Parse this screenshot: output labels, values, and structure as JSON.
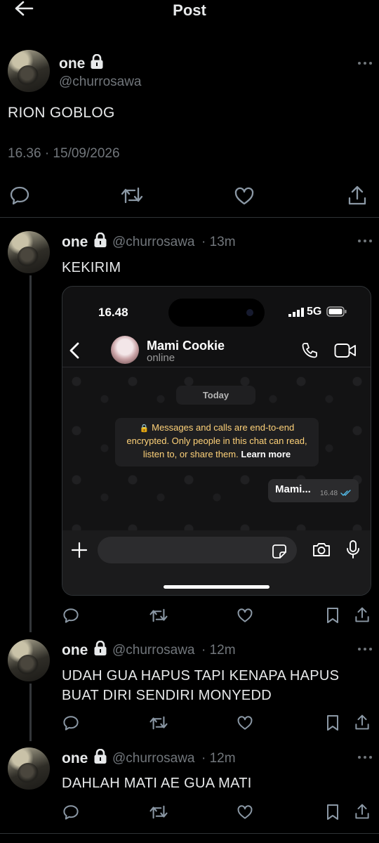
{
  "header": {
    "title": "Post"
  },
  "main_post": {
    "name": "one",
    "handle": "@churrosawa",
    "text": "RION GOBLOG",
    "timestamp": "16.36 · 15/09/2026"
  },
  "replies": [
    {
      "name": "one",
      "handle": "@churrosawa",
      "age": "· 13m",
      "text": "KEKIRIM"
    },
    {
      "name": "one",
      "handle": "@churrosawa",
      "age": "· 12m",
      "text_line1": "UDAH GUA HAPUS TAPI KENAPA HAPUS",
      "text_line2": "BUAT DIRI SENDIRI MONYEDD"
    },
    {
      "name": "one",
      "handle": "@churrosawa",
      "age": "· 12m",
      "text": "DAHLAH MATI AE GUA MATI"
    }
  ],
  "embedded": {
    "time": "16.48",
    "network": "5G",
    "contact_name": "Mami Cookie",
    "contact_status": "online",
    "date_chip": "Today",
    "encryption_line1": "Messages and calls are end-to-end",
    "encryption_line2": "encrypted. Only people in this chat can read,",
    "encryption_line3": "listen to, or share them.",
    "learn_more": "Learn more",
    "message_text": "Mami...",
    "message_time": "16.48"
  },
  "colors": {
    "background": "#000000",
    "text": "#e7e9ea",
    "secondary": "#71767b",
    "divider": "#2f3336",
    "encryption_text": "#ffd279",
    "read_tick": "#53bdeb"
  },
  "icons": [
    "back-arrow-icon",
    "lock-icon",
    "more-icon",
    "reply-icon",
    "retweet-icon",
    "like-icon",
    "bookmark-icon",
    "share-icon",
    "phone-icon",
    "video-icon",
    "plus-icon",
    "sticker-icon",
    "camera-icon",
    "mic-icon"
  ]
}
